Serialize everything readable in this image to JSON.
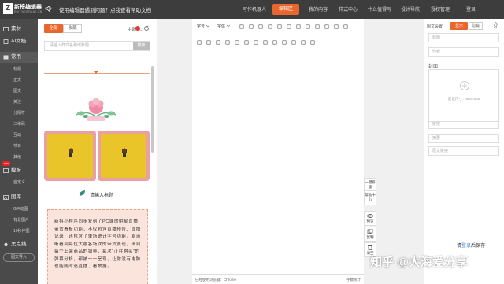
{
  "topbar": {
    "logo_glyph": "Z",
    "brand": "新榜编辑器",
    "brand_sub": "EDIT.NEWRANK.CN",
    "notice": "使用编辑器遇到问题？点我查看帮助文档",
    "nav": [
      "写作机器人",
      "编辑区",
      "我的内容",
      "样式中心",
      "什么值得写",
      "设计导航",
      "授权管理",
      "登录"
    ],
    "active_index": 1,
    "accent": "#e9662d"
  },
  "left_nav": {
    "main1": "素材",
    "main2": "AI文档",
    "main3": "常用",
    "sub_common": [
      "标题",
      "正文",
      "图文",
      "关注",
      "分隔符",
      "二维码",
      "互动",
      "节日",
      "其他"
    ],
    "new_badge": "new",
    "main4": "模板",
    "sub_template": [
      "自定义"
    ],
    "main5": "图库",
    "sub_gallery": [
      "GIF动图",
      "背景图片",
      "10秒作图"
    ],
    "main6": "黑点线",
    "import_btn": "图文导入"
  },
  "material": {
    "tab_all": "全部",
    "tab_fav": "收藏",
    "theme_label": "主题色：",
    "theme_color": "#e53935",
    "search_placeholder": "请输入样式名称或标题",
    "search_btn": "搜索",
    "title_placeholder": "请输入标题",
    "note_text": "新抖小程序同步复刻了PC端的明星直播带货看板功能，不仅包含直播预告、直播记录，还包含了单场统计字号功能，能清晰看到每位大咖各场次的带货表现，细到每个上架商品的销量，每次“正在购买”的弹幕分析，都被一一呈现，让你没有电脑也能随时追直播、看数据。"
  },
  "toolbar": {
    "font_size": "字号",
    "font": "字体"
  },
  "status": {
    "path": "已经使用浏览器：Chrome",
    "count": "字数统计"
  },
  "actions": [
    "一键排版",
    "帮助中心",
    "预览",
    "复制",
    "清空"
  ],
  "settings": {
    "label": "图文设置",
    "tab_active": "显示",
    "tab_inactive": "隐藏",
    "title_placeholder": "标题",
    "author_placeholder": "作者",
    "cover_label": "封面",
    "cover_size": "建议尺寸：900×500",
    "link_placeholder": "链接",
    "digest_placeholder": "摘要",
    "original_placeholder": "原文链接",
    "save_tip_pre": "请",
    "save_tip_link": "登录",
    "save_tip_post": "后保存"
  },
  "watermark": "知乎 @大海爱分享"
}
